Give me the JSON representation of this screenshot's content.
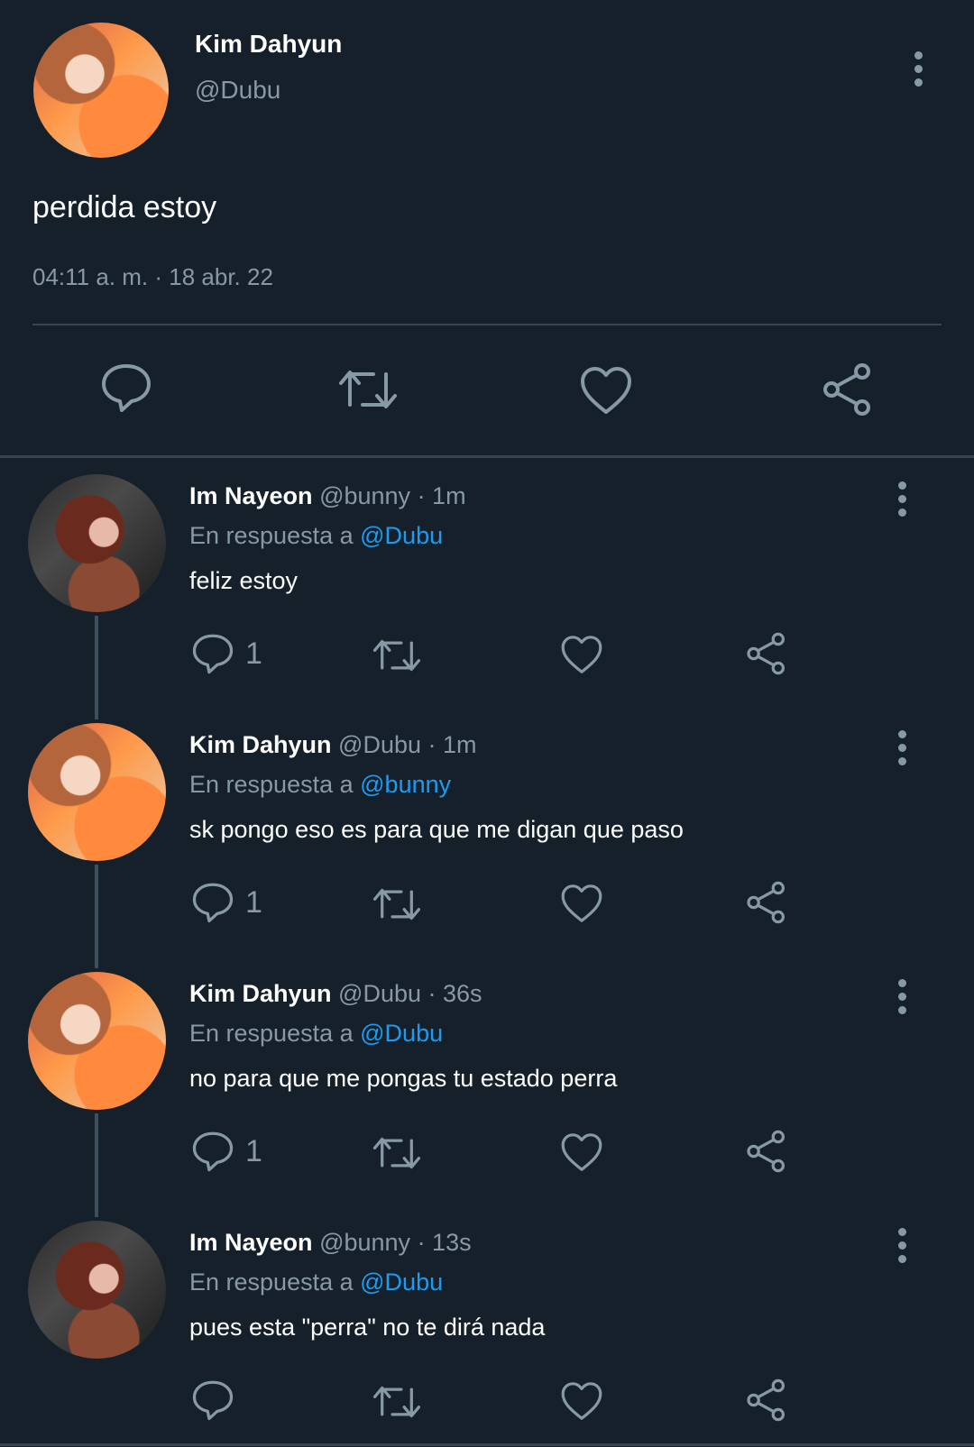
{
  "main_tweet": {
    "author_name": "Kim Dahyun",
    "handle": "@Dubu",
    "text": "perdida estoy",
    "timestamp": "04:11 a. m. · 18 abr. 22"
  },
  "replies": [
    {
      "author_name": "Im Nayeon",
      "handle": "@bunny",
      "time": "· 1m",
      "reply_prefix": "En respuesta a",
      "reply_to": "@Dubu",
      "text": "feliz estoy",
      "reply_count": "1"
    },
    {
      "author_name": "Kim Dahyun",
      "handle": "@Dubu",
      "time": "· 1m",
      "reply_prefix": "En respuesta a",
      "reply_to": "@bunny",
      "text": "sk pongo eso es para que me digan que paso",
      "reply_count": "1"
    },
    {
      "author_name": "Kim Dahyun",
      "handle": "@Dubu",
      "time": "· 36s",
      "reply_prefix": "En respuesta a",
      "reply_to": "@Dubu",
      "text": "no para que me pongas tu estado perra",
      "reply_count": "1"
    },
    {
      "author_name": "Im Nayeon",
      "handle": "@bunny",
      "time": "· 13s",
      "reply_prefix": "En respuesta a",
      "reply_to": "@Dubu",
      "text": "pues esta \"perra\" no te dirá nada",
      "reply_count": ""
    }
  ],
  "icons": {
    "reply": "reply-icon",
    "retweet": "retweet-icon",
    "like": "heart-icon",
    "share": "share-icon",
    "more": "more-vertical-icon"
  },
  "colors": {
    "background": "#15202b",
    "muted": "#8899a6",
    "link": "#1d9bf0",
    "divider": "#38444d"
  }
}
